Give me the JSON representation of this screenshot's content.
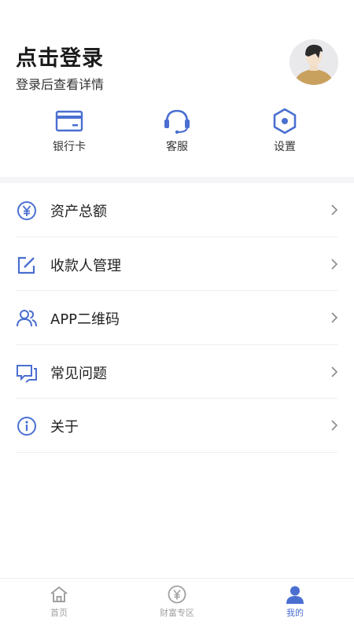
{
  "header": {
    "title": "点击登录",
    "subtitle": "登录后查看详情"
  },
  "quick_actions": [
    {
      "label": "银行卡",
      "icon": "bank-card-icon"
    },
    {
      "label": "客服",
      "icon": "headset-icon"
    },
    {
      "label": "设置",
      "icon": "settings-hexagon-icon"
    }
  ],
  "menu": [
    {
      "label": "资产总额",
      "icon": "yen-circle-icon"
    },
    {
      "label": "收款人管理",
      "icon": "edit-square-icon"
    },
    {
      "label": "APP二维码",
      "icon": "users-icon"
    },
    {
      "label": "常见问题",
      "icon": "chat-bubbles-icon"
    },
    {
      "label": "关于",
      "icon": "info-circle-icon"
    }
  ],
  "tabbar": [
    {
      "label": "首页",
      "icon": "home-icon",
      "active": false
    },
    {
      "label": "财富专区",
      "icon": "yen-circle-icon",
      "active": false
    },
    {
      "label": "我的",
      "icon": "user-icon",
      "active": true
    }
  ],
  "colors": {
    "accent": "#4a6fd1",
    "inactive": "#a0a0a0"
  }
}
